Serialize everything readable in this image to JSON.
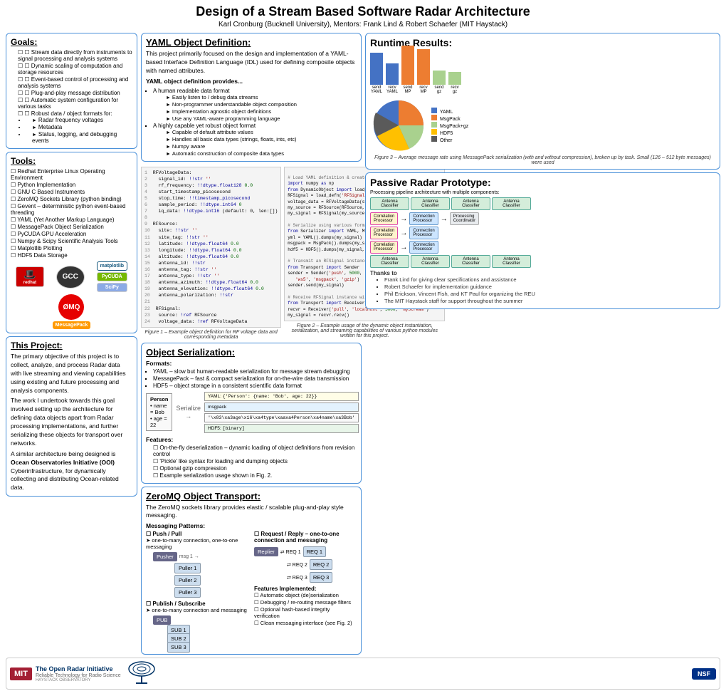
{
  "title": "Design of a Stream Based Software Radar Architecture",
  "subtitle": "Karl Cronburg (Bucknell University), Mentors: Frank Lind & Robert Schaefer (MIT Haystack)",
  "goals": {
    "title": "Goals:",
    "items": [
      "Stream data directly from instruments to signal processing and analysis systems",
      "Dynamic scaling of computation and storage resources",
      "Event-based control of processing and analysis systems",
      "Plug-and-play message distribution",
      "Automatic system configuration for various tasks",
      "Robust data / object formats for:",
      "Radar frequency voltages",
      "Metadata",
      "Status, logging, and debugging events"
    ]
  },
  "tools": {
    "title": "Tools:",
    "items": [
      "Redhat Enterprise Linux Operating Environment",
      "Python Implementation",
      "GNU C Based Instruments",
      "ZeroMQ Sockets Library (python binding)",
      "Gevent – deterministic python event-based threading",
      "YAML (Yet Another Markup Language)",
      "MessagePack Object Serialization",
      "PyCUDA GPU Acceleration",
      "Numpy & Scipy Scientific Analysis Tools",
      "Matplotlib Plotting",
      "HDF5 Data Storage"
    ]
  },
  "this_project": {
    "title": "This Project:",
    "para1": "The primary objective of this project is to collect, analyze, and process Radar data with live streaming and viewing capabilities using existing and future processing and analysis components.",
    "para2": "The work I undertook towards this goal involved setting up the architecture for defining data objects apart from Radar processing implementations, and further serializing these objects for transport over networks.",
    "para3": "A similar architecture being designed is Ocean Observatories Initiative (OOI) Cyberinfrastructure, for dynamically collecting and distributing Ocean-related data."
  },
  "yaml": {
    "title": "YAML Object Definition:",
    "description": "This project primarily focused on the design and implementation of a YAML-based Interface Definition Language (IDL) used for defining composite objects with named attributes.",
    "provides_title": "YAML object definition provides...",
    "provides": [
      "A human readable data format",
      "Easily listen to / debug data streams",
      "Non-programmer understandable object composition",
      "Implementation agnostic object definitions",
      "Use any YAML-aware programming language",
      "A highly capable yet robust object format",
      "Capable of default attribute values",
      "Handles all basic data types (strings, floats, ints, etc)",
      "Numpy aware",
      "Automatic construction of composite data types"
    ]
  },
  "serialization": {
    "title": "Object Serialization:",
    "formats_title": "Formats:",
    "formats": [
      "YAML – slow but human-readable serialization for message stream debugging",
      "MessagePack – fast & compact serialization for on-the-wire data transmission",
      "HDF5 – object storage in a consistent scientific data format"
    ],
    "features_title": "Features:",
    "features": [
      "On-the-fly deserialization – dynamic loading of object definitions from revision control",
      "'Pickle' like syntax for loading and dumping objects",
      "Optional gzip compression",
      "Example serialization usage shown in Fig. 2."
    ],
    "figure1_caption": "Figure 1 – Example object definition for RF voltage data and corresponding metadata",
    "figure2_caption": "Figure 2 – Example usage of the dynamic object instantiation, serialization, and streaming capabilities of various python modules written for this project."
  },
  "zeromq": {
    "title": "ZeroMQ Object Transport:",
    "description": "The ZeroMQ sockets library provides elastic / scalable plug-and-play style messaging.",
    "patterns_title": "Messaging Patterns:",
    "patterns": [
      "Push / Pull",
      "one-to-many connection, one-to-one messaging",
      "Request / Reply – one-to-one connection and messaging",
      "Publish / Subscribe",
      "one-to-many connection and messaging"
    ],
    "features_title": "Features Implemented:",
    "features": [
      "Automatic object (de)serialization",
      "Debugging / re-routing message filters",
      "Optional hash-based integrity verification",
      "Clean messaging interface (see Fig. 2)"
    ]
  },
  "runtime": {
    "title": "Runtime Results:",
    "description": "Average message rate using MessagePack serialization (with and without compression), broken up by task. Small (126 – 512 byte messages) were used",
    "figure3_caption": "Figure 3 – Average message rate using MessagePack serialization (with and without compression), broken up by task. Small (126 – 512 byte messages) were used"
  },
  "passive_radar": {
    "title": "Passive Radar Prototype:",
    "thanks_title": "Thanks to",
    "thanks": [
      "Frank Lind for giving clear specifications and assistance",
      "Robert Schaefer for implementation guidance",
      "Phil Erickson, Vincent Fish, and KT Paul for organizing the REU",
      "The MIT Haystack staff for support throughout the summer"
    ]
  },
  "footer": {
    "org_name": "The Open Radar Initiative",
    "org_tagline": "Reliable Technology for Radio Science",
    "haystack": "HAYSTACK OBSERVATORY"
  },
  "code": {
    "yaml_sample": "1 RFVoltageData:\n2   signal_id: !!str ''\n3   rf_frequency: !!dtype.float128 0.0\n4   start_timestamp_picosecond\n5   stop_time: !!timestamp_picosecond\n6   sample_period: !!dtype.int64 0\n7   iq_data: !!dtype.int16 (default: 0, len:[])\n8\n9 RFSource:\n10  site: !!str ''\n11  site_tag: !!str ''\n12  latitude: !!dtype.float64 0.0\n13  longitude: !!dtype.float64 0.0\n14  altitude: !!dtype.float64 0.0\n15  antenna_id: !!str\n16  antenna_tag: !!str ''\n17  antenna_type: !!str ''\n18  antenna_azimuth: !!dtype.float64 0.0\n19  antenna_elevation: !!dtype.float64 0.0\n20  antenna_polarization: !!str\n21\n22 RFSignal:\n23  source: !ref RFSource\n24  voltage_data: !ref RFVoltageData",
    "python_sample": "# Load YAML definition & create RFSignal instance:\nimport numpy as np\nfrom DynamicObject import load_defn\nRFSignal = load_defn('RFSignal.yml')\nvoltage_data = RFVoltageData(start=rf_field(10, 100), ...)\nmy_source = RFSource(RFSource, RFSignal, = ...)\nmy_signal = RFSignal(my_source, voltage_data)\n\n# Serialize using various formats & compression:\nfrom Serializer import YAML, MsgPack, HDF5\nyml = YAML().dumps(my_signal)\nmsgpack = MsgPack().dumps(my_signal)\nhdf5 = HDF5().dumps(my_signal, 'gzip')\n\n# Transmit an RFSignal instance:\nfrom Transport import Sender\nsender = Sender('push', 5000, 'myStream', 'ws5', 'msgpack', 'gzip')\nsender.send(my_signal)\n\n# Receive RFSignal instance with on-the-fly deserialization:\nfrom Transport import Receiver\nrecvr = Receiver('pull', 'localhost', 5000, 'myStream')\nmy_signal = recvr.recv()"
  }
}
